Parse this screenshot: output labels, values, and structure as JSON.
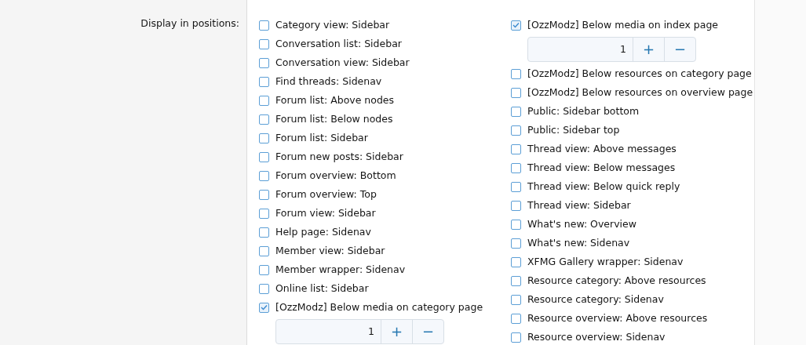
{
  "label": "Display in positions:",
  "columns": [
    [
      {
        "label": "Category view: Sidebar",
        "checked": false
      },
      {
        "label": "Conversation list: Sidebar",
        "checked": false
      },
      {
        "label": "Conversation view: Sidebar",
        "checked": false
      },
      {
        "label": "Find threads: Sidenav",
        "checked": false
      },
      {
        "label": "Forum list: Above nodes",
        "checked": false
      },
      {
        "label": "Forum list: Below nodes",
        "checked": false
      },
      {
        "label": "Forum list: Sidebar",
        "checked": false
      },
      {
        "label": "Forum new posts: Sidebar",
        "checked": false
      },
      {
        "label": "Forum overview: Bottom",
        "checked": false
      },
      {
        "label": "Forum overview: Top",
        "checked": false
      },
      {
        "label": "Forum view: Sidebar",
        "checked": false
      },
      {
        "label": "Help page: Sidenav",
        "checked": false
      },
      {
        "label": "Member view: Sidebar",
        "checked": false
      },
      {
        "label": "Member wrapper: Sidenav",
        "checked": false
      },
      {
        "label": "Online list: Sidebar",
        "checked": false
      },
      {
        "label": "[OzzModz] Below media on category page",
        "checked": true,
        "order": "1",
        "plus": "+",
        "minus": "−"
      }
    ],
    [
      {
        "label": "[OzzModz] Below media on index page",
        "checked": true,
        "order": "1",
        "plus": "+",
        "minus": "−"
      },
      {
        "label": "[OzzModz] Below resources on category page",
        "checked": false
      },
      {
        "label": "[OzzModz] Below resources on overview page",
        "checked": false
      },
      {
        "label": "Public: Sidebar bottom",
        "checked": false
      },
      {
        "label": "Public: Sidebar top",
        "checked": false
      },
      {
        "label": "Thread view: Above messages",
        "checked": false
      },
      {
        "label": "Thread view: Below messages",
        "checked": false
      },
      {
        "label": "Thread view: Below quick reply",
        "checked": false
      },
      {
        "label": "Thread view: Sidebar",
        "checked": false
      },
      {
        "label": "What's new: Overview",
        "checked": false
      },
      {
        "label": "What's new: Sidenav",
        "checked": false
      },
      {
        "label": "XFMG Gallery wrapper: Sidenav",
        "checked": false
      },
      {
        "label": "Resource category: Above resources",
        "checked": false
      },
      {
        "label": "Resource category: Sidenav",
        "checked": false
      },
      {
        "label": "Resource overview: Above resources",
        "checked": false
      },
      {
        "label": "Resource overview: Sidenav",
        "checked": false
      }
    ]
  ]
}
